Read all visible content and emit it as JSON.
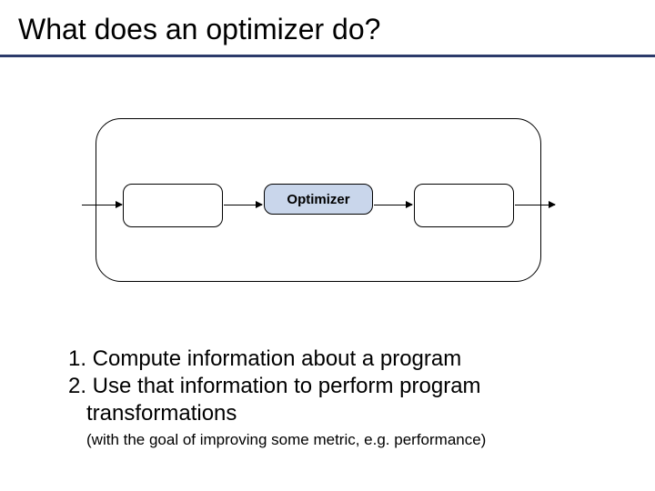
{
  "title": "What does an optimizer do?",
  "optimizer_label": "Optimizer",
  "point1": "1. Compute information about a program",
  "point2_a": "2. Use that information to perform program",
  "point2_b": "transformations",
  "subnote": "(with the goal of improving some metric, e.g. performance)"
}
